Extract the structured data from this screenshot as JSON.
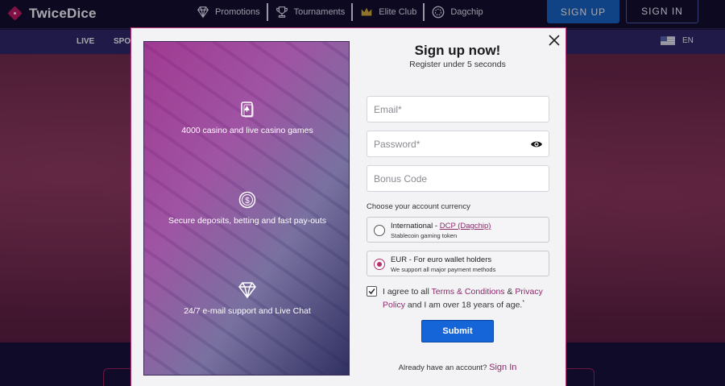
{
  "header": {
    "logo_text": "TwiceDice",
    "nav": [
      {
        "label": "Promotions",
        "icon": "diamond-icon"
      },
      {
        "label": "Tournaments",
        "icon": "trophy-icon"
      },
      {
        "label": "Elite Club",
        "icon": "crown-icon"
      },
      {
        "label": "Dagchip",
        "icon": "chip-icon"
      }
    ],
    "signup_label": "SIGN UP",
    "signin_label": "SIGN IN"
  },
  "subnav": {
    "items": [
      "LIVE",
      "SPO"
    ],
    "language": "EN"
  },
  "modal": {
    "title": "Sign up now!",
    "subtitle": "Register under 5 seconds",
    "features": [
      {
        "text": "4000 casino and live casino games",
        "icon": "cards-icon"
      },
      {
        "text": "Secure deposits, betting and fast pay-outs",
        "icon": "dollar-coin-icon"
      },
      {
        "text": "24/7 e-mail support and Live Chat",
        "icon": "diamond-icon"
      }
    ],
    "email_placeholder": "Email*",
    "password_placeholder": "Password*",
    "bonus_placeholder": "Bonus Code",
    "currency_label": "Choose your account currency",
    "currency_options": [
      {
        "prefix": "International - ",
        "link": "DCP (Dagchip)",
        "note": "Stablecoin gaming token",
        "selected": false
      },
      {
        "prefix": "EUR - For euro wallet holders",
        "link": "",
        "note": "We support all major payment methods",
        "selected": true
      }
    ],
    "terms": {
      "pre": "I agree to all ",
      "terms_link": "Terms & Conditions",
      "mid": " & ",
      "privacy_link": "Privacy Policy",
      "post": " and I am over 18 years of age.",
      "asterisk": "*",
      "checked": true
    },
    "submit_label": "Submit",
    "already_text": "Already have an account? ",
    "signin_link": "Sign In"
  },
  "colors": {
    "accent": "#b5306f",
    "primary_button": "#1565d8",
    "header_bg": "#0f0b24",
    "subnav_bg": "#2b2560"
  }
}
